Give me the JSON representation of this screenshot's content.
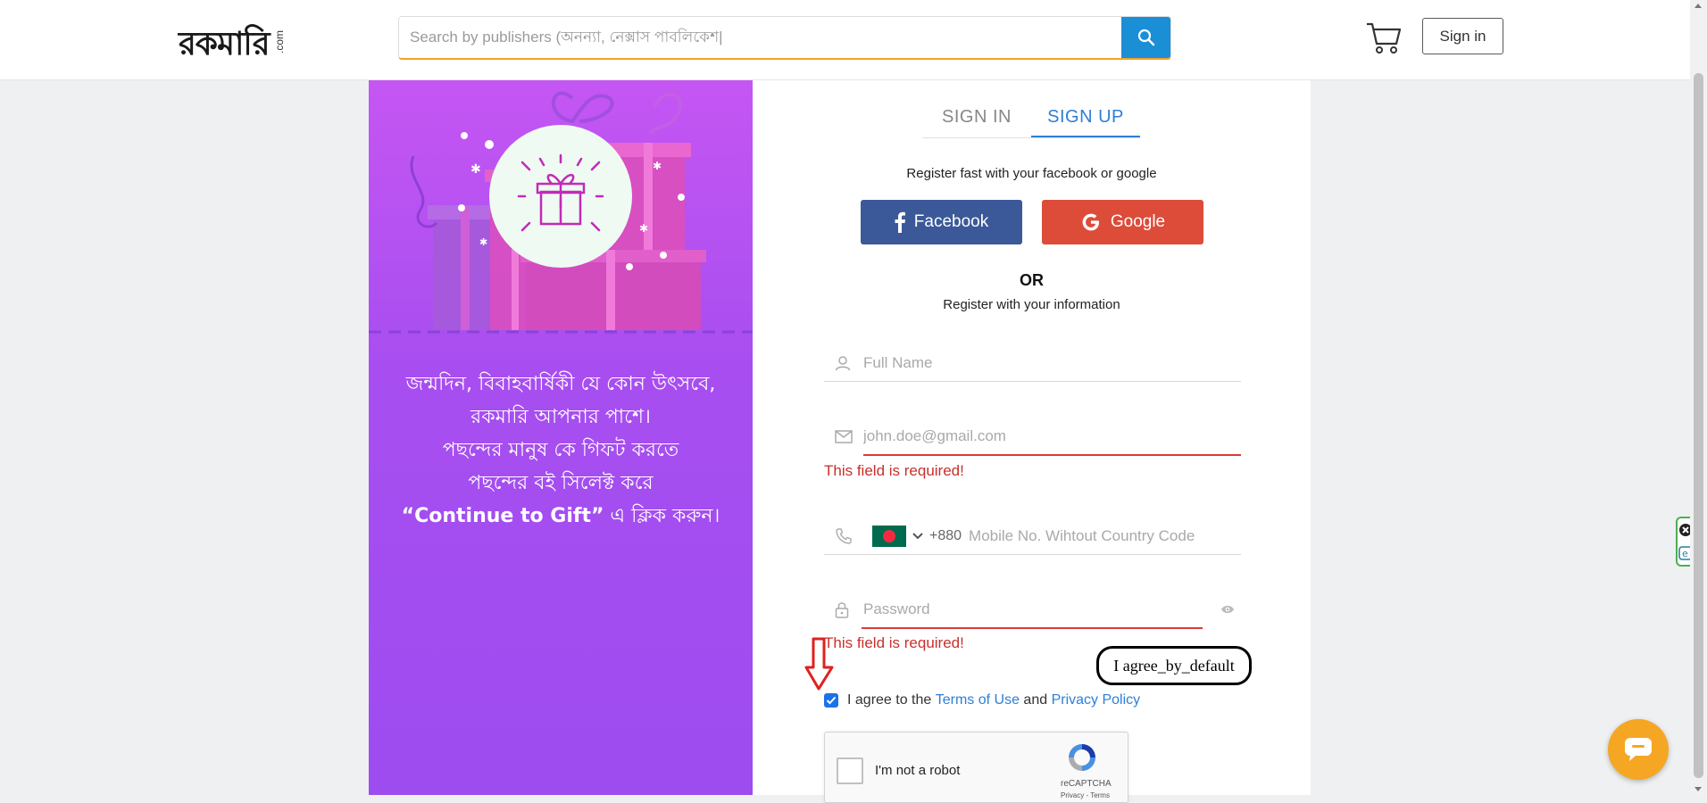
{
  "header": {
    "logo": {
      "main": "রকমারি",
      "suffix": ".com"
    },
    "search": {
      "placeholder": "Search by publishers (অনন্যা, নেক্সাস পাবলিকেশ|",
      "button_icon": "search-icon"
    },
    "cart_icon": "cart-icon",
    "signin_label": "Sign in"
  },
  "promo": {
    "lines": [
      "জন্মদিন, বিবাহবার্ষিকী যে কোন উৎসবে,",
      "রকমারি আপনার পাশে।",
      "পছন্দের মানুষ কে গিফট করতে",
      "পছন্দের বই সিলেক্ট করে"
    ],
    "last_line_bold": "“Continue to Gift”",
    "last_line_rest": " এ ক্লিক করুন।",
    "colors": {
      "top": "#c556f3",
      "bottom": "#9d4cf0"
    }
  },
  "auth": {
    "tabs": [
      {
        "label": "SIGN IN",
        "active": false
      },
      {
        "label": "SIGN UP",
        "active": true
      }
    ],
    "social_prompt": "Register fast with your facebook or google",
    "facebook_label": "Facebook",
    "google_label": "Google",
    "or_label": "OR",
    "register_prompt": "Register with your information",
    "fields": {
      "full_name": {
        "placeholder": "Full Name",
        "icon": "user-icon"
      },
      "email": {
        "placeholder": "john.doe@gmail.com",
        "icon": "envelope-icon",
        "error": "This field is required!"
      },
      "mobile": {
        "placeholder": "Mobile No. Wihtout Country Code",
        "icon": "phone-icon",
        "country_code": "+880",
        "flag": "bangladesh-flag"
      },
      "password": {
        "placeholder": "Password",
        "icon": "lock-icon",
        "toggle_icon": "eye-icon",
        "error": "This field is required!"
      }
    },
    "agree": {
      "checked": true,
      "prefix": "I agree to the ",
      "terms": "Terms of Use",
      "middle": " and ",
      "privacy": "Privacy Policy"
    },
    "recaptcha": {
      "label": "I'm not a robot",
      "brand": "reCAPTCHA",
      "links": "Privacy - Terms"
    }
  },
  "annotation": {
    "bubble_text": "I agree_by_default",
    "arrow_color": "#e02020"
  },
  "colors": {
    "accent_blue": "#2d7fd6",
    "facebook": "#3b5998",
    "google": "#dd4b39",
    "error": "#c9302c",
    "search_border": "#f2a12c",
    "chat": "#f5a623"
  }
}
